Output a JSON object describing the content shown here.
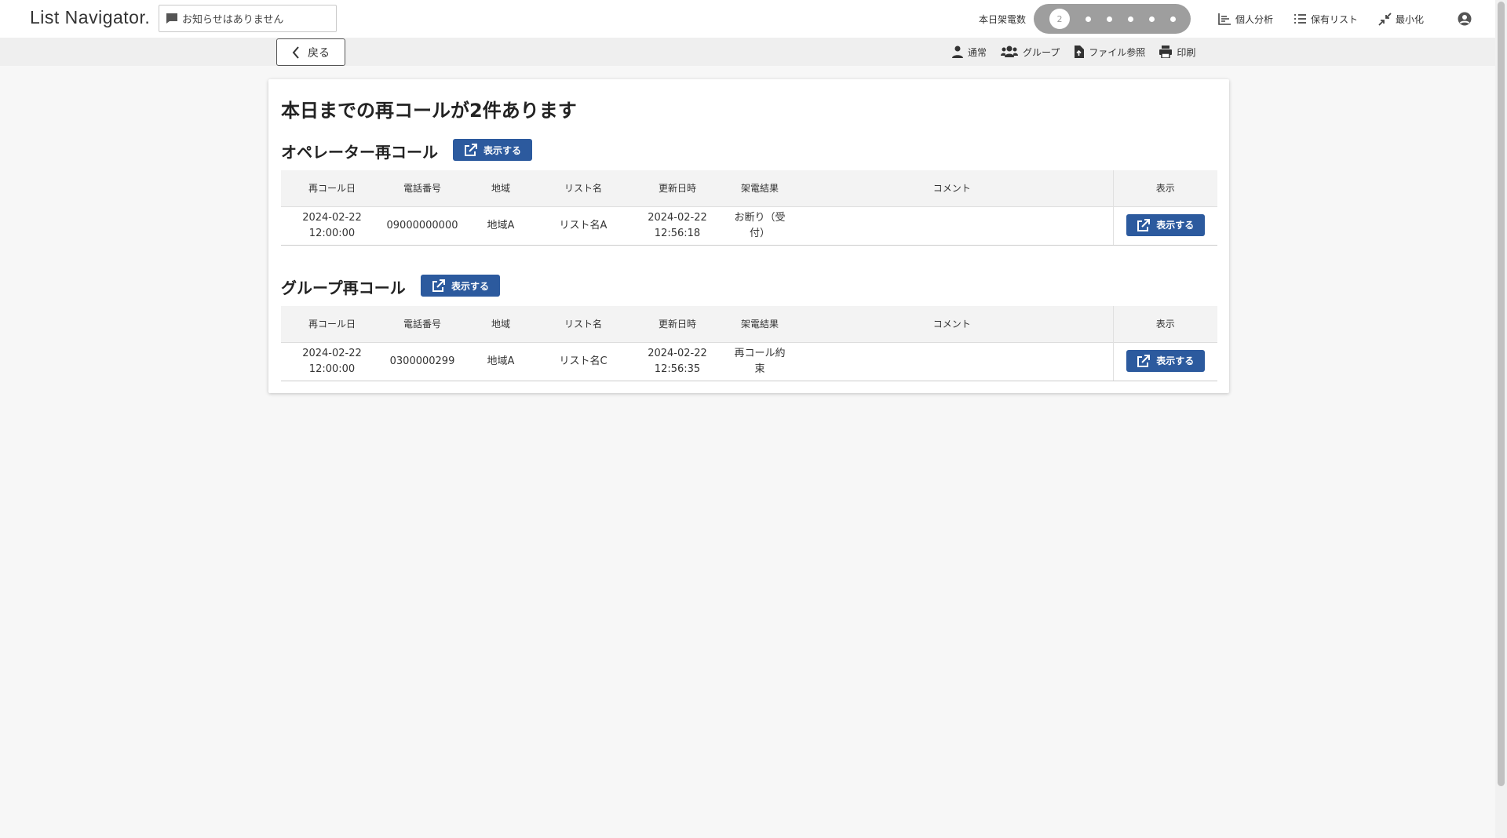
{
  "app": {
    "logo": "List Navigator.",
    "notice": "お知らせはありません",
    "calls_label": "本日架電数",
    "calls_count": "2",
    "actions": [
      "個人分析",
      "保有リスト",
      "最小化"
    ]
  },
  "subbar": {
    "back": "戻る",
    "actions": [
      "通常",
      "グループ",
      "ファイル参照",
      "印刷"
    ]
  },
  "main": {
    "headline": "本日までの再コールが2件あります",
    "view_label": "表示する",
    "columns": [
      "再コール日",
      "電話番号",
      "地域",
      "リスト名",
      "更新日時",
      "架電結果",
      "コメント",
      "表示"
    ],
    "sections": [
      {
        "title": "オペレーター再コール",
        "rows": [
          {
            "recall_date": "2024-02-22",
            "recall_time": "12:00:00",
            "phone": "09000000000",
            "region": "地域A",
            "list": "リスト名A",
            "updated_date": "2024-02-22",
            "updated_time": "12:56:18",
            "result_line1": "お断り（受",
            "result_line2": "付）",
            "comment": ""
          }
        ]
      },
      {
        "title": "グループ再コール",
        "rows": [
          {
            "recall_date": "2024-02-22",
            "recall_time": "12:00:00",
            "phone": "0300000299",
            "region": "地域A",
            "list": "リスト名C",
            "updated_date": "2024-02-22",
            "updated_time": "12:56:35",
            "result_line1": "再コール約",
            "result_line2": "束",
            "comment": ""
          }
        ]
      }
    ]
  }
}
